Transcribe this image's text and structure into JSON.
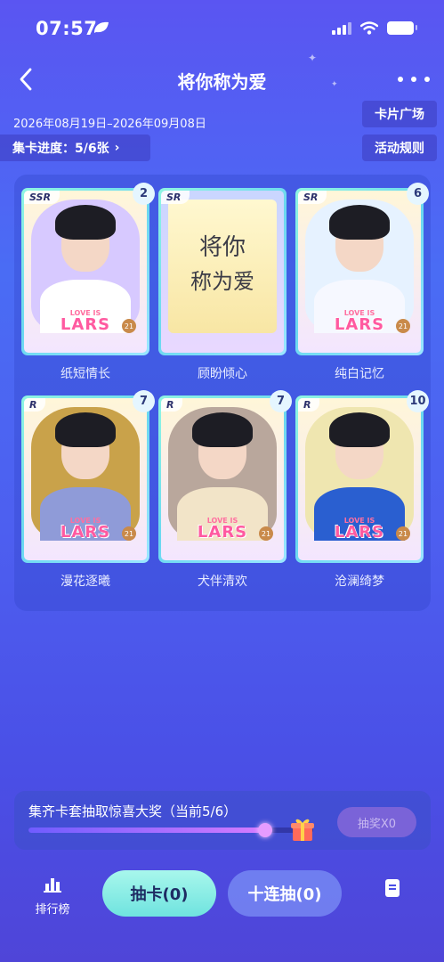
{
  "status_bar": {
    "time": "07:57"
  },
  "nav": {
    "title": "将你称为爱"
  },
  "header": {
    "date_range": "2026年08月19日–2026年09月08日",
    "progress_label": "集卡进度：5/6张",
    "progress_chevron": "›",
    "plaza_label": "卡片广场",
    "rules_label": "活动规则"
  },
  "cards": [
    {
      "name": "纸短情长",
      "rarity": "SSR",
      "count": "2",
      "bg": "#d7c9ff",
      "body": "#ffffff"
    },
    {
      "name": "顾盼倾心",
      "rarity": "SR",
      "count": "",
      "bg": "#f6ecb0",
      "body": "#f0d4ef"
    },
    {
      "name": "纯白记忆",
      "rarity": "SR",
      "count": "6",
      "bg": "#e6f2ff",
      "body": "#f6f8ff"
    },
    {
      "name": "漫花逐曦",
      "rarity": "R",
      "count": "7",
      "bg": "#c9a24a",
      "body": "#8f9bd8"
    },
    {
      "name": "犬伴清欢",
      "rarity": "R",
      "count": "7",
      "bg": "#b9a79c",
      "body": "#f2e4c8"
    },
    {
      "name": "沧澜绮梦",
      "rarity": "R",
      "count": "10",
      "bg": "#efe6b0",
      "body": "#2a5fd0"
    }
  ],
  "card_art": {
    "love_text": "LOVE IS",
    "lars_text": "LARS",
    "seal_text": "21",
    "feature_handwriting_1": "将你",
    "feature_handwriting_2": "称为爱"
  },
  "bonus": {
    "label": "集齐卡套抽取惊喜大奖（当前5/6）",
    "progress": 0.83,
    "draw_label": "抽奖X0"
  },
  "bottom_bar": {
    "rank_label": "排行榜",
    "draw_one_label": "抽卡(0)",
    "draw_ten_label": "十连抽(0)"
  },
  "colors": {
    "accent_cyan": "#6fe3df",
    "badge_bg": "#e5f6ff"
  }
}
